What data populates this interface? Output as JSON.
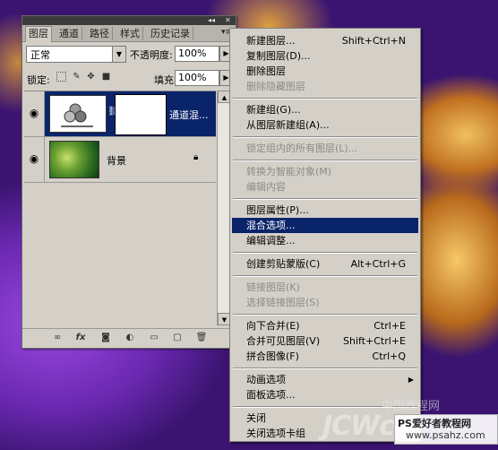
{
  "panel": {
    "tabs": [
      {
        "label": "图层"
      },
      {
        "label": "通道"
      },
      {
        "label": "路径"
      },
      {
        "label": "样式"
      },
      {
        "label": "历史记录"
      }
    ],
    "collapse_glyph": "◂◂",
    "close_glyph": "✕",
    "menu_glyph": "▾≡",
    "blend_mode": "正常",
    "opacity_label": "不透明度:",
    "opacity_value": "100%",
    "lock_label": "锁定:",
    "fill_label": "填充:",
    "fill_value": "100%",
    "layers": [
      {
        "name": "通道混...",
        "selected": true
      },
      {
        "name": "背景",
        "selected": false
      }
    ]
  },
  "menu": {
    "items": [
      {
        "label": "新建图层...",
        "shortcut": "Shift+Ctrl+N",
        "enabled": true
      },
      {
        "label": "复制图层(D)...",
        "shortcut": "",
        "enabled": true
      },
      {
        "label": "删除图层",
        "shortcut": "",
        "enabled": true
      },
      {
        "label": "删除隐藏图层",
        "shortcut": "",
        "enabled": false
      },
      {
        "label": "新建组(G)...",
        "shortcut": "",
        "enabled": true
      },
      {
        "label": "从图层新建组(A)...",
        "shortcut": "",
        "enabled": true
      },
      {
        "label": "锁定组内的所有图层(L)...",
        "shortcut": "",
        "enabled": false
      },
      {
        "label": "转换为智能对象(M)",
        "shortcut": "",
        "enabled": false
      },
      {
        "label": "编辑内容",
        "shortcut": "",
        "enabled": false
      },
      {
        "label": "图层属性(P)...",
        "shortcut": "",
        "enabled": true
      },
      {
        "label": "混合选项...",
        "shortcut": "",
        "enabled": true,
        "highlighted": true
      },
      {
        "label": "编辑调整...",
        "shortcut": "",
        "enabled": true
      },
      {
        "label": "创建剪贴蒙版(C)",
        "shortcut": "Alt+Ctrl+G",
        "enabled": true
      },
      {
        "label": "链接图层(K)",
        "shortcut": "",
        "enabled": false
      },
      {
        "label": "选择链接图层(S)",
        "shortcut": "",
        "enabled": false
      },
      {
        "label": "向下合并(E)",
        "shortcut": "Ctrl+E",
        "enabled": true
      },
      {
        "label": "合并可见图层(V)",
        "shortcut": "Shift+Ctrl+E",
        "enabled": true
      },
      {
        "label": "拼合图像(F)",
        "shortcut": "Ctrl+Q",
        "enabled": true
      },
      {
        "label": "动画选项",
        "shortcut": "",
        "enabled": true,
        "submenu": true
      },
      {
        "label": "面板选项...",
        "shortcut": "",
        "enabled": true
      },
      {
        "label": "关闭",
        "shortcut": "",
        "enabled": true
      },
      {
        "label": "关闭选项卡组",
        "shortcut": "",
        "enabled": true
      }
    ]
  },
  "watermark": {
    "big": "JCWcn",
    "top": "中国教程网",
    "line1": "PS爱好者教程网",
    "line2": "www.psahz.com"
  },
  "colors": {
    "selection": "#0a246a",
    "panel_bg": "#d4d0c8"
  }
}
